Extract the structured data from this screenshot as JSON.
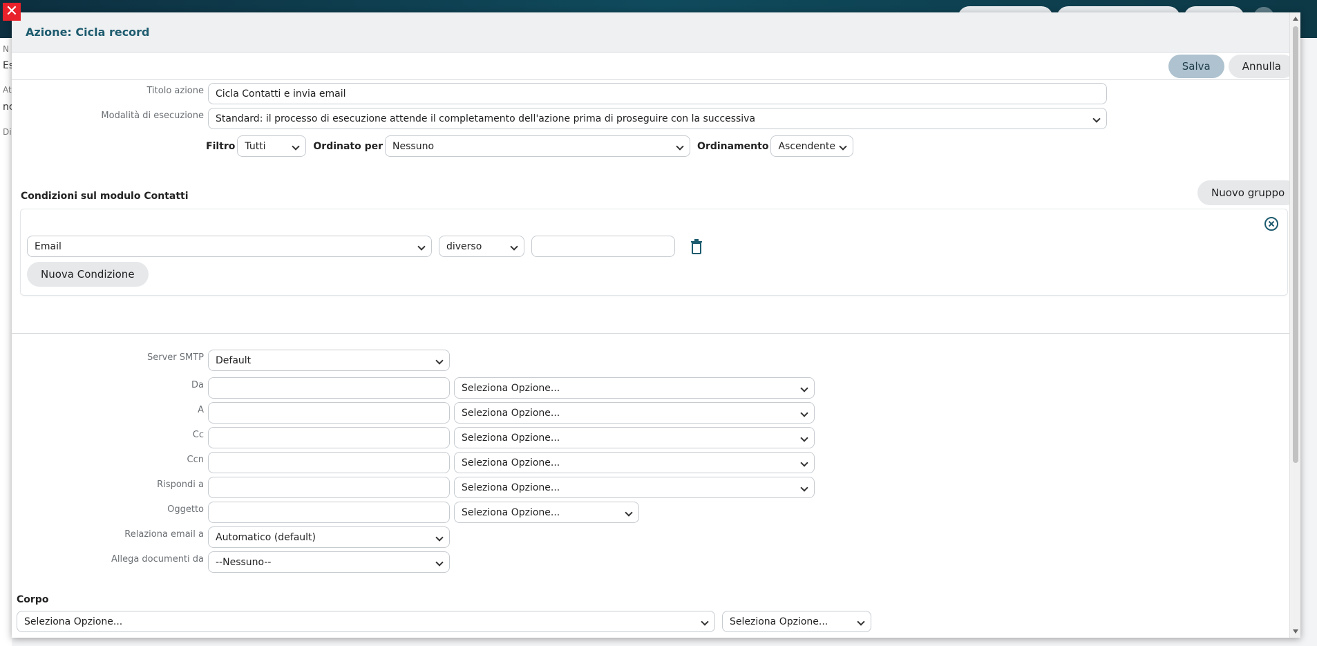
{
  "modal": {
    "title": "Azione: Cicla record",
    "save_label": "Salva",
    "cancel_label": "Annulla"
  },
  "form": {
    "action_title_label": "Titolo azione",
    "action_title_value": "Cicla Contatti e invia email",
    "exec_mode_label": "Modalità di esecuzione",
    "exec_mode_value": "Standard: il processo di esecuzione attende il completamento dell'azione prima di proseguire con la successiva",
    "filter_label": "Filtro",
    "filter_value": "Tutti",
    "order_by_label": "Ordinato per",
    "order_by_value": "Nessuno",
    "ordering_label": "Ordinamento",
    "ordering_value": "Ascendente"
  },
  "conditions": {
    "title": "Condizioni sul modulo Contatti",
    "new_group_label": "Nuovo gruppo",
    "field_value": "Email",
    "operator_value": "diverso",
    "value_input": "",
    "new_condition_label": "Nuova Condizione"
  },
  "email": {
    "smtp_label": "Server SMTP",
    "smtp_value": "Default",
    "select_placeholder": "Seleziona Opzione...",
    "rows": [
      {
        "label": "Da",
        "value": ""
      },
      {
        "label": "A",
        "value": ""
      },
      {
        "label": "Cc",
        "value": ""
      },
      {
        "label": "Ccn",
        "value": ""
      },
      {
        "label": "Rispondi a",
        "value": ""
      },
      {
        "label": "Oggetto",
        "value": ""
      }
    ],
    "relate_label": "Relaziona email a",
    "relate_value": "Automatico (default)",
    "attach_label": "Allega documenti da",
    "attach_value": "--Nessuno--",
    "body_label": "Corpo"
  },
  "background": {
    "left_letters": [
      "N",
      "Es",
      "At",
      "nc",
      "Di"
    ]
  },
  "colors": {
    "accent": "#1d5b6e",
    "close": "#e8212a",
    "primary_button": "#aec2cf"
  }
}
